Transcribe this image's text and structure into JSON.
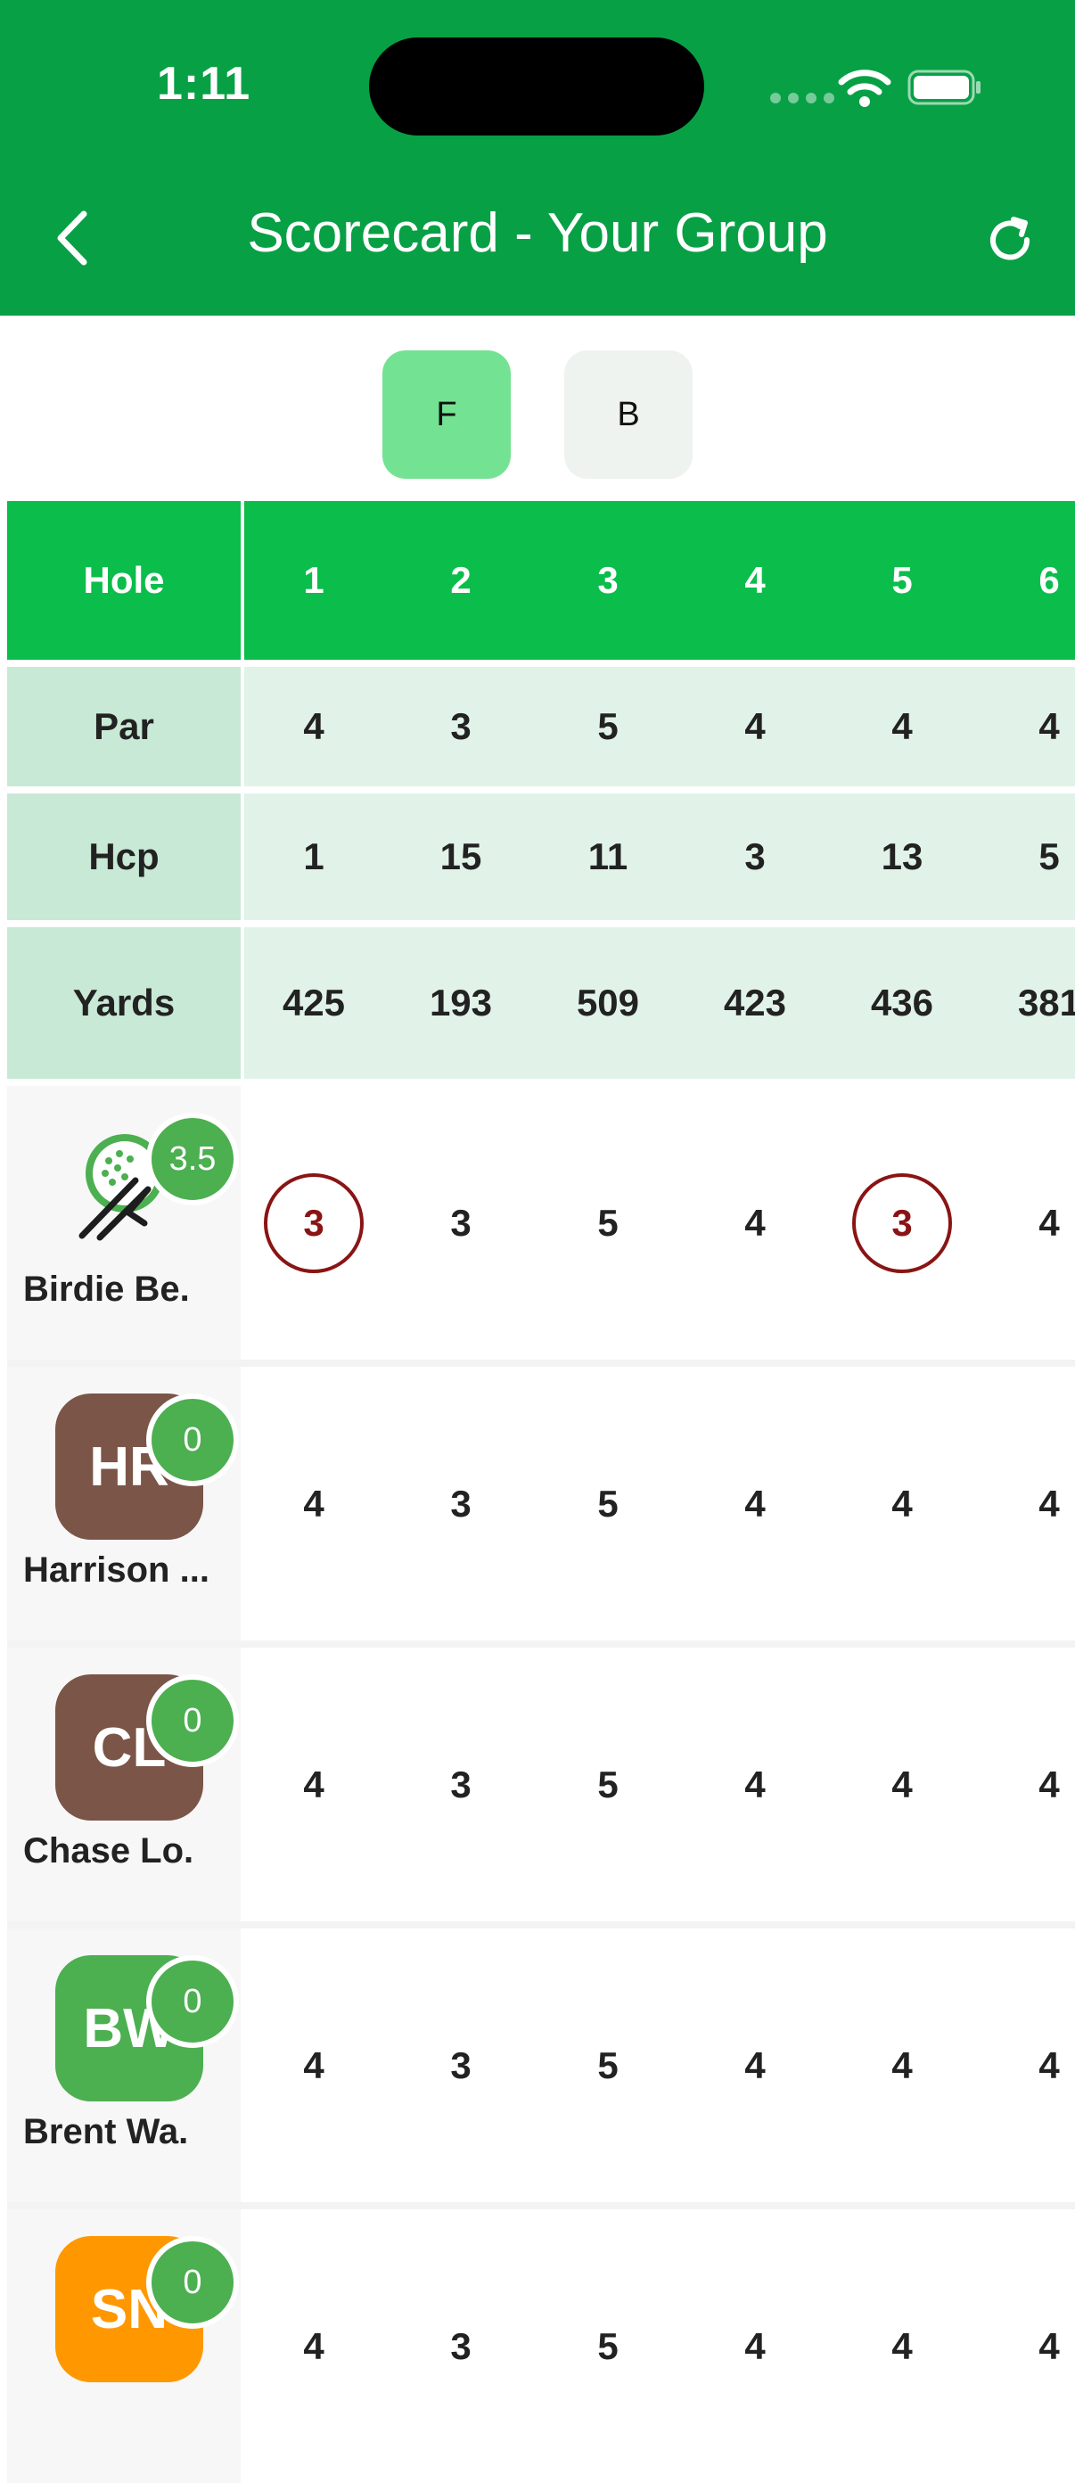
{
  "status_bar": {
    "time": "1:11"
  },
  "header": {
    "title": "Scorecard - Your Group"
  },
  "nine_toggle": {
    "front": "F",
    "back": "B",
    "selected": "F"
  },
  "scorecard": {
    "hole_label": "Hole",
    "par_label": "Par",
    "hcp_label": "Hcp",
    "yards_label": "Yards",
    "holes": [
      "1",
      "2",
      "3",
      "4",
      "5",
      "6"
    ],
    "par": [
      "4",
      "3",
      "5",
      "4",
      "4",
      "4"
    ],
    "hcp": [
      "1",
      "15",
      "11",
      "3",
      "13",
      "5"
    ],
    "yards": [
      "425",
      "193",
      "509",
      "423",
      "436",
      "381"
    ]
  },
  "players": [
    {
      "name": "Birdie Be.",
      "handicap": "3.5",
      "initials": "",
      "avatar_color": "",
      "scores": [
        "3",
        "3",
        "5",
        "4",
        "3",
        "4"
      ],
      "birdies": [
        0,
        4
      ]
    },
    {
      "name": "Harrison ...",
      "handicap": "0",
      "initials": "HR",
      "avatar_color": "#7a5548",
      "scores": [
        "4",
        "3",
        "5",
        "4",
        "4",
        "4"
      ],
      "birdies": []
    },
    {
      "name": "Chase Lo.",
      "handicap": "0",
      "initials": "CL",
      "avatar_color": "#7a5548",
      "scores": [
        "4",
        "3",
        "5",
        "4",
        "4",
        "4"
      ],
      "birdies": []
    },
    {
      "name": "Brent Wa.",
      "handicap": "0",
      "initials": "BW",
      "avatar_color": "#4caf50",
      "scores": [
        "4",
        "3",
        "5",
        "4",
        "4",
        "4"
      ],
      "birdies": []
    },
    {
      "name": "",
      "handicap": "0",
      "initials": "SN",
      "avatar_color": "#ff9800",
      "scores": [
        "4",
        "3",
        "5",
        "4",
        "4",
        "4"
      ],
      "birdies": []
    }
  ],
  "colors": {
    "header_green": "#08a045",
    "hole_row_green": "#0bbd4b",
    "selected_toggle": "#74e293",
    "birdie_circle": "#8a1414"
  }
}
